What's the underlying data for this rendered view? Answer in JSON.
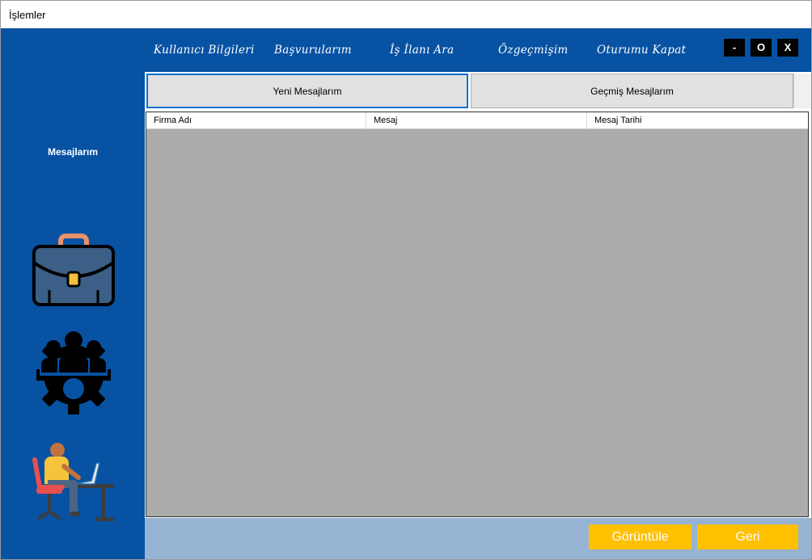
{
  "window": {
    "title": "İşlemler"
  },
  "nav": {
    "items": [
      "Kullanıcı Bilgileri",
      "Başvurularım",
      "İş İlanı Ara",
      "Özgeçmişim",
      "Oturumu Kapat"
    ]
  },
  "window_controls": {
    "minimize": "-",
    "maximize": "O",
    "close": "X"
  },
  "sidebar": {
    "section_label": "Mesajlarım"
  },
  "tabs": [
    {
      "label": "Yeni Mesajlarım",
      "selected": true
    },
    {
      "label": "Geçmiş Mesajlarım",
      "selected": false
    }
  ],
  "table": {
    "columns": [
      "Firma Adı",
      "Mesaj",
      "Mesaj Tarihi"
    ],
    "rows": []
  },
  "buttons": {
    "view": "Görüntüle",
    "back": "Geri"
  },
  "colors": {
    "primary": "#0752a3",
    "accent": "#ffc000",
    "footer": "#97b3d3",
    "grid": "#ababab"
  },
  "icons": [
    "briefcase-icon",
    "team-gear-icon",
    "person-at-desk-icon"
  ]
}
